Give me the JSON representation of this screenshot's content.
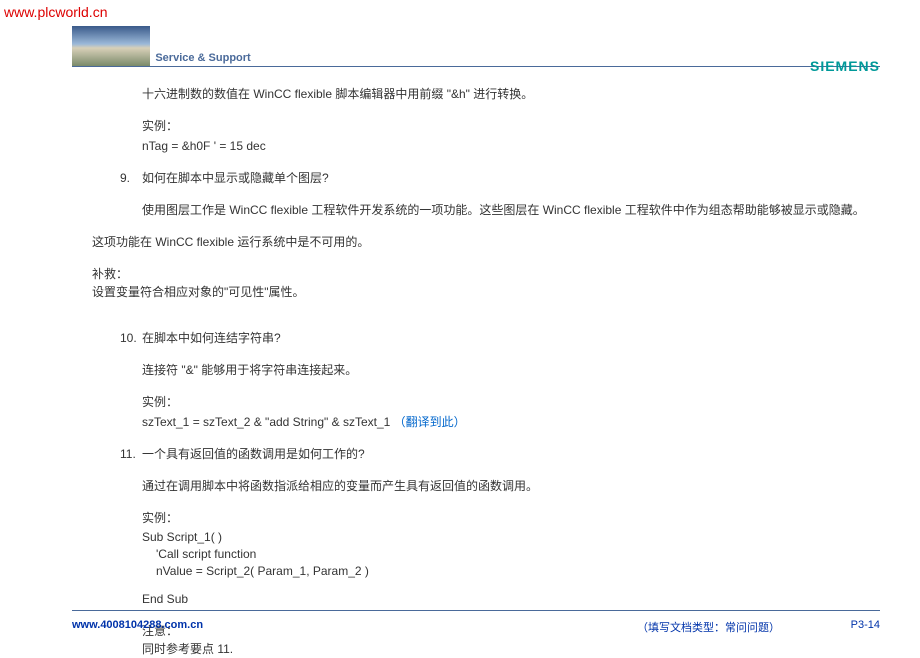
{
  "watermark": "www.plcworld.cn",
  "header": {
    "service_support": "Service & Support",
    "siemens": "SIEMENS"
  },
  "content": {
    "intro_line": "十六进制数的数值在 WinCC flexible 脚本编辑器中用前缀 \"&h\" 进行转换。",
    "example_label_1": "实例：",
    "example_code_1": "nTag = &h0F '  = 15 dec",
    "q9_num": "9.",
    "q9_text": "如何在脚本中显示或隐藏单个图层?",
    "q9_answer": "使用图层工作是 WinCC flexible 工程软件开发系统的一项功能。这些图层在 WinCC flexible 工程软件中作为组态帮助能够被显示或隐藏。",
    "q9_note1": "这项功能在 WinCC flexible 运行系统中是不可用的。",
    "q9_fix_label": "补救：",
    "q9_fix_text": "设置变量符合相应对象的\"可见性\"属性。",
    "q10_num": "10.",
    "q10_text": "在脚本中如何连结字符串?",
    "q10_answer": "连接符 \"&\" 能够用于将字符串连接起来。",
    "example_label_2": "实例：",
    "example_code_2": "szText_1 = szText_2 & \"add String\" & szText_1",
    "translate_link": "（翻译到此）",
    "q11_num": "11.",
    "q11_text": "一个具有返回值的函数调用是如何工作的?",
    "q11_answer": "通过在调用脚本中将函数指派给相应的变量而产生具有返回值的函数调用。",
    "example_label_3": "实例：",
    "code_line_1": "Sub Script_1( )",
    "code_line_2": "'Call script function",
    "code_line_3": "nValue = Script_2( Param_1, Param_2 )",
    "code_line_4": "End Sub",
    "note_label": "注意：",
    "note_text": "同时参考要点 11."
  },
  "footer": {
    "link": "www.4008104288.com.cn",
    "doctype": "（填写文档类型：常问问题）",
    "page": "P3-14"
  }
}
